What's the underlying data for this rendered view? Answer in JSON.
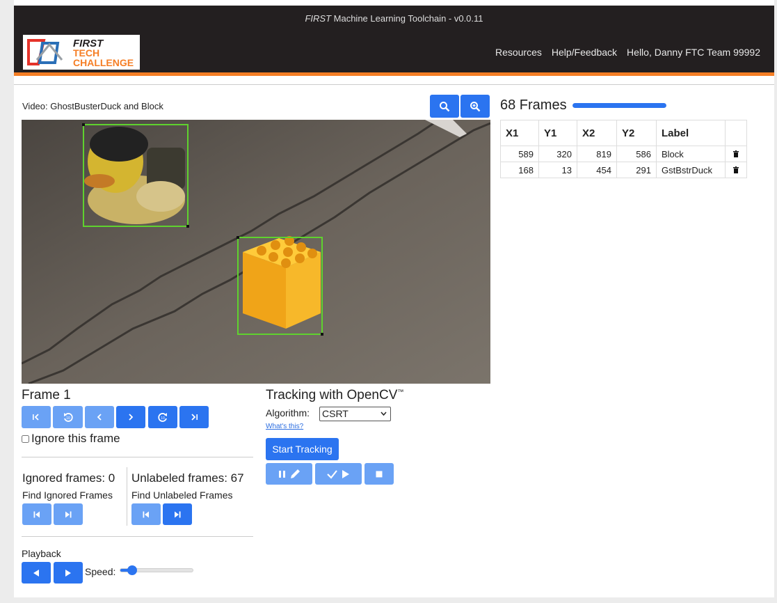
{
  "header": {
    "title_brand": "FIRST",
    "title_rest": " Machine Learning Toolchain - v0.0.11",
    "logo_line1": "FIRST",
    "logo_line2": "TECH",
    "logo_line3": "CHALLENGE",
    "nav": {
      "resources": "Resources",
      "help": "Help/Feedback",
      "user": "Hello, Danny FTC Team 99992"
    }
  },
  "video": {
    "label": "Video: GhostBusterDuck and Block",
    "zoom_out_icon": "zoom-out-icon",
    "zoom_in_icon": "zoom-in-icon"
  },
  "frames_panel": {
    "title": "68 Frames",
    "progress_fraction": 1.0,
    "columns": [
      "X1",
      "Y1",
      "X2",
      "Y2",
      "Label"
    ],
    "rows": [
      {
        "x1": "589",
        "y1": "320",
        "x2": "819",
        "y2": "586",
        "label": "Block"
      },
      {
        "x1": "168",
        "y1": "13",
        "x2": "454",
        "y2": "291",
        "label": "GstBstrDuck"
      }
    ]
  },
  "frame_nav": {
    "title": "Frame 1",
    "buttons": [
      "first-frame-icon",
      "back-10-icon",
      "previous-frame-icon",
      "next-frame-icon",
      "forward-10-icon",
      "last-frame-icon"
    ],
    "ignore_label": "Ignore this frame",
    "ignore_checked": false
  },
  "ignored": {
    "label": "Ignored frames: 0",
    "find": "Find Ignored Frames"
  },
  "unlabeled": {
    "label": "Unlabeled frames: 67",
    "find": "Find Unlabeled Frames"
  },
  "tracking": {
    "title": "Tracking with OpenCV",
    "tm": "™",
    "algorithm_label": "Algorithm:",
    "algorithm_value": "CSRT",
    "whats_this": "What's this?",
    "start_button": "Start Tracking",
    "controls": [
      "pause-edit-icon",
      "accept-continue-icon",
      "stop-icon"
    ]
  },
  "playback": {
    "label": "Playback",
    "speed_label": "Speed:",
    "speed_fraction": 0.12
  },
  "colors": {
    "accent": "#2b74f0",
    "accent_light": "#6aa2f5",
    "header": "#231f20",
    "header_stripe": "#f57e25",
    "box": "#5fd22e"
  }
}
